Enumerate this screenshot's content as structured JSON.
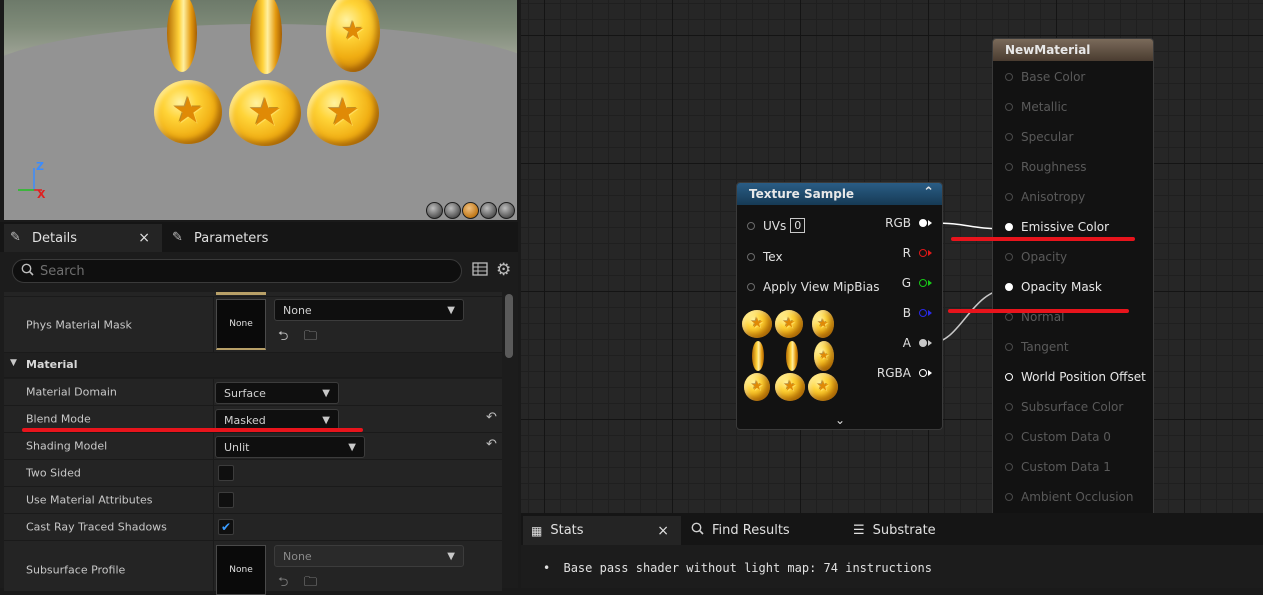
{
  "viewport": {
    "gizmo": {
      "z": "Z",
      "x": "X"
    },
    "view_buttons": [
      "sphere-preview-icon",
      "sphere-preview-icon",
      "teapot-preview-icon",
      "sphere-preview-icon",
      "realtime-toggle-icon"
    ]
  },
  "details": {
    "tabs": [
      {
        "label": "Details",
        "close": "×",
        "active": true
      },
      {
        "label": "Parameters",
        "active": false
      }
    ],
    "search": {
      "placeholder": "Search"
    },
    "phys_material_mask": {
      "label": "Phys Material Mask",
      "thumb_text": "None",
      "value": "None"
    },
    "material_section": {
      "title": "Material"
    },
    "rows": [
      {
        "label": "Material Domain",
        "value": "Surface"
      },
      {
        "label": "Blend Mode",
        "value": "Masked"
      },
      {
        "label": "Shading Model",
        "value": "Unlit"
      },
      {
        "label": "Two Sided",
        "checked": false
      },
      {
        "label": "Use Material Attributes",
        "checked": false
      },
      {
        "label": "Cast Ray Traced Shadows",
        "checked": true
      }
    ],
    "subsurface_profile": {
      "label": "Subsurface Profile",
      "thumb_text": "None",
      "value": "None"
    }
  },
  "graph": {
    "texture_sample": {
      "title": "Texture Sample",
      "inputs": [
        {
          "label": "UVs",
          "value": "0"
        },
        {
          "label": "Tex"
        },
        {
          "label": "Apply View MipBias"
        }
      ],
      "outputs": [
        {
          "label": "RGB",
          "color": "#ffffff"
        },
        {
          "label": "R",
          "color": "#e01818"
        },
        {
          "label": "G",
          "color": "#18c818"
        },
        {
          "label": "B",
          "color": "#2a2ae8"
        },
        {
          "label": "A",
          "color": "#c8c8c8"
        },
        {
          "label": "RGBA",
          "color": "#ffffff"
        }
      ]
    },
    "new_material": {
      "title": "NewMaterial",
      "inputs": [
        {
          "label": "Base Color",
          "active": false
        },
        {
          "label": "Metallic",
          "active": false
        },
        {
          "label": "Specular",
          "active": false
        },
        {
          "label": "Roughness",
          "active": false
        },
        {
          "label": "Anisotropy",
          "active": false
        },
        {
          "label": "Emissive Color",
          "active": true
        },
        {
          "label": "Opacity",
          "active": false
        },
        {
          "label": "Opacity Mask",
          "active": true
        },
        {
          "label": "Normal",
          "active": false
        },
        {
          "label": "Tangent",
          "active": false
        },
        {
          "label": "World Position Offset",
          "active": true
        },
        {
          "label": "Subsurface Color",
          "active": false
        },
        {
          "label": "Custom Data 0",
          "active": false
        },
        {
          "label": "Custom Data 1",
          "active": false
        },
        {
          "label": "Ambient Occlusion",
          "active": false
        }
      ]
    }
  },
  "bottom": {
    "tabs": [
      {
        "label": "Stats",
        "close": "×",
        "active": true
      },
      {
        "label": "Find Results",
        "active": false
      },
      {
        "label": "Substrate",
        "active": false
      }
    ],
    "stats_line": "Base pass shader without light map: 74 instructions"
  },
  "colors": {
    "annotation_red": "#e8141c",
    "texture_header": "#1f4a6b",
    "material_header": "#5a4a3c"
  }
}
